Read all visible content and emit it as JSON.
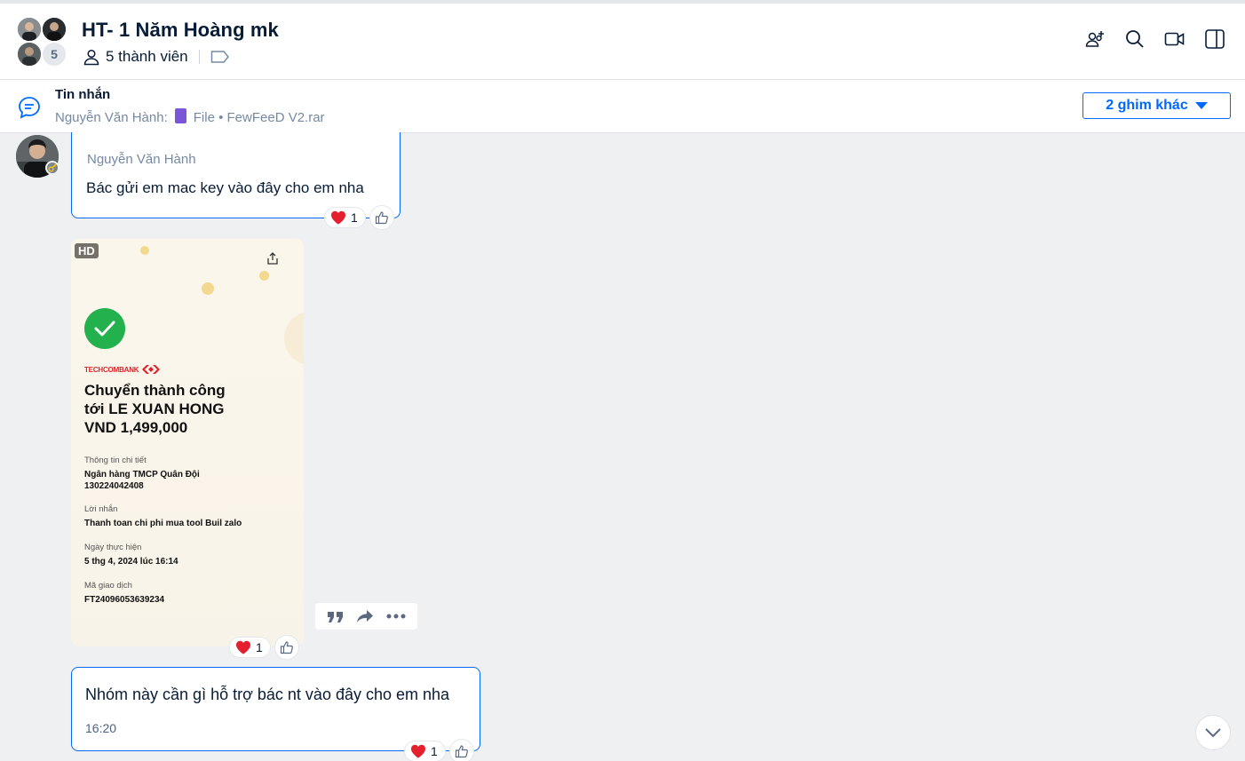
{
  "header": {
    "group_name": "HT- 1 Năm Hoàng mk",
    "avatar_count": "5",
    "members_label": "5 thành viên",
    "icons": [
      "add-member-icon",
      "search-icon",
      "video-call-icon",
      "sidebar-toggle-icon"
    ]
  },
  "pinned": {
    "title": "Tin nhắn",
    "sender": "Nguyễn Văn Hành:",
    "file_label": "File • FewFeeD V2.rar",
    "more_button": "2 ghim khác"
  },
  "messages": [
    {
      "sender": "Nguyễn Văn Hành",
      "text": "Bác gửi em mac key vào đây cho em nha",
      "reaction_count": "1"
    },
    {
      "type": "image",
      "hd_badge": "HD",
      "reaction_count": "1",
      "receipt": {
        "bank": "TECHCOMBANK",
        "title_line1": "Chuyển thành công",
        "title_line2": "tới LE XUAN HONG",
        "title_line3": "VND 1,499,000",
        "detail_label": "Thông tin chi tiết",
        "detail_bank": "Ngân hàng TMCP Quân Đội",
        "detail_account": "130224042408",
        "note_label": "Lời nhắn",
        "note_value": "Thanh toan chi phi mua tool Buil zalo",
        "date_label": "Ngày thực hiện",
        "date_value": "5 thg 4, 2024 lúc 16:14",
        "txn_label": "Mã giao dịch",
        "txn_value": "FT24096053639234"
      }
    },
    {
      "text": "Nhóm này cần gì hỗ trợ bác nt vào đây cho em nha",
      "time": "16:20",
      "reaction_count": "1"
    }
  ],
  "colors": {
    "accent": "#0068ff",
    "text": "#081c36",
    "muted": "#7589a3",
    "success": "#22b14c",
    "bank_red": "#e0232a"
  }
}
